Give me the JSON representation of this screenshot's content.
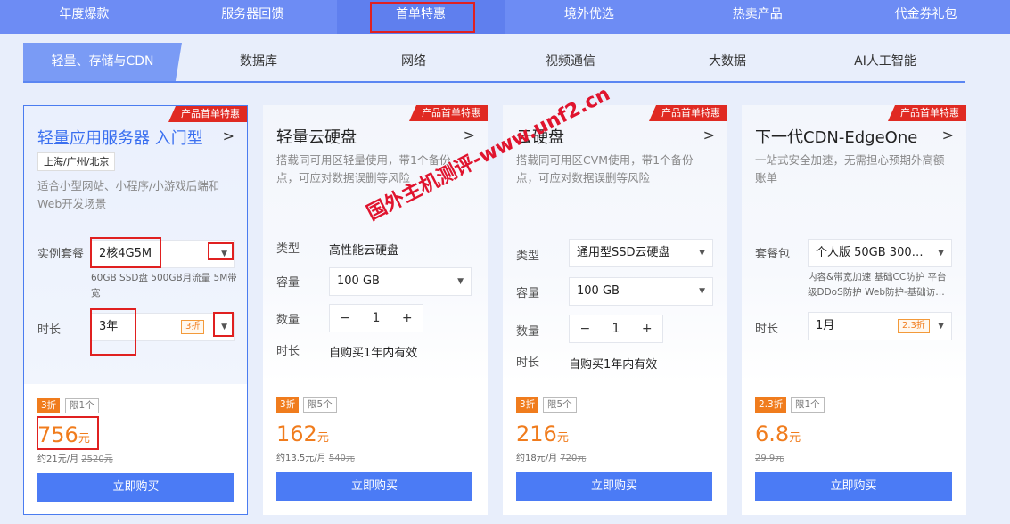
{
  "top_tabs": [
    "年度爆款",
    "服务器回馈",
    "首单特惠",
    "境外优选",
    "热卖产品",
    "代金券礼包"
  ],
  "sub_tabs": [
    "轻量、存储与CDN",
    "数据库",
    "网络",
    "视频通信",
    "大数据",
    "AI人工智能"
  ],
  "ribbon": "产品首单特惠",
  "buy_label": "立即购买",
  "watermark": "国外主机测评-www.unf2.cn",
  "cards": [
    {
      "title": "轻量应用服务器 入门型",
      "chevron": ">",
      "region": "上海/广州/北京",
      "desc": "适合小型网站、小程序/小游戏后端和Web开发场景",
      "plan_label": "实例套餐",
      "plan_value": "2核4G5M",
      "plan_spec": "60GB SSD盘 500GB月流量 5M带宽",
      "duration_label": "时长",
      "duration_value": "3年",
      "duration_discount": "3折",
      "discount_badge": "3折",
      "limit_badge": "限1个",
      "price": "756",
      "unit": "元",
      "monthly": "约21元/月",
      "original": "2520元"
    },
    {
      "title": "轻量云硬盘",
      "chevron": ">",
      "desc": "搭载同可用区轻量使用，带1个备份点，可应对数据误删等风险",
      "type_label": "类型",
      "type_value": "高性能云硬盘",
      "capacity_label": "容量",
      "capacity_value": "100 GB",
      "qty_label": "数量",
      "qty_minus": "−",
      "qty_value": "1",
      "qty_plus": "+",
      "duration_label": "时长",
      "duration_value": "自购买1年内有效",
      "discount_badge": "3折",
      "limit_badge": "限5个",
      "price": "162",
      "unit": "元",
      "monthly": "约13.5元/月",
      "original": "540元"
    },
    {
      "title": "云硬盘",
      "chevron": ">",
      "desc": "搭载同可用区CVM使用，带1个备份点，可应对数据误删等风险",
      "type_label": "类型",
      "type_value": "通用型SSD云硬盘",
      "capacity_label": "容量",
      "capacity_value": "100 GB",
      "qty_label": "数量",
      "qty_minus": "−",
      "qty_value": "1",
      "qty_plus": "+",
      "duration_label": "时长",
      "duration_value": "自购买1年内有效",
      "discount_badge": "3折",
      "limit_badge": "限5个",
      "price": "216",
      "unit": "元",
      "monthly": "约18元/月",
      "original": "720元"
    },
    {
      "title": "下一代CDN-EdgeOne",
      "chevron": ">",
      "desc": "一站式安全加速，无需担心预期外高额账单",
      "plan_label": "套餐包",
      "plan_value": "个人版 50GB 300…",
      "plan_spec_1": "内容&带宽加速 基础CC防护 平台",
      "plan_spec_2": "级DDoS防护 Web防护-基础访…",
      "duration_label": "时长",
      "duration_value": "1月",
      "duration_discount": "2.3折",
      "discount_badge": "2.3折",
      "limit_badge": "限1个",
      "price": "6.8",
      "unit": "元",
      "original": "29.9元"
    }
  ],
  "colors": {
    "accent": "#4b7bf5",
    "nav": "#6d8cf4",
    "price": "#f07c1d",
    "ribbon": "#e02a22",
    "annotation": "#e02020"
  }
}
